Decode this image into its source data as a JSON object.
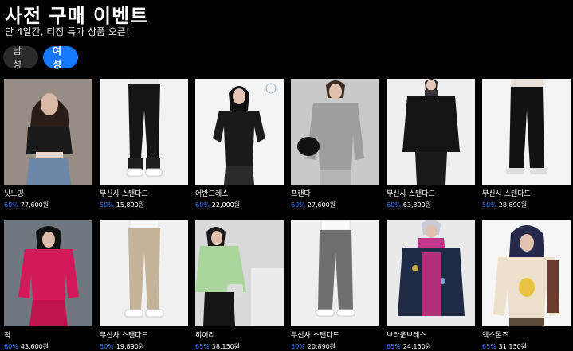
{
  "header": {
    "title": "사전 구매 이벤트",
    "subtitle": "단 4일간, 티징 특가 상품 오픈!"
  },
  "tabs": [
    {
      "label": "남성",
      "active": false
    },
    {
      "label": "여성",
      "active": true
    }
  ],
  "products": [
    {
      "name": "낫노밍",
      "discount": "60%",
      "price": "77,600원",
      "image": "woman-black-leather-crop-vest-denim"
    },
    {
      "name": "무신사 스탠다드",
      "discount": "50%",
      "price": "15,890원",
      "image": "black-jogger-pants-white-sneakers"
    },
    {
      "name": "어반드레스",
      "discount": "60%",
      "price": "22,000원",
      "image": "woman-black-cropped-cardigan"
    },
    {
      "name": "프랜다",
      "discount": "60%",
      "price": "27,600원",
      "image": "woman-grey-sweatshirt-black-bag"
    },
    {
      "name": "무신사 스탠다드",
      "discount": "60%",
      "price": "63,890원",
      "image": "black-double-breasted-coat"
    },
    {
      "name": "무신사 스탠다드",
      "discount": "50%",
      "price": "28,890원",
      "image": "black-wide-slacks"
    },
    {
      "name": "척",
      "discount": "60%",
      "price": "43,600원",
      "image": "woman-pink-hooded-zip-up-set"
    },
    {
      "name": "무신사 스탠다드",
      "discount": "50%",
      "price": "19,890원",
      "image": "beige-tapered-pants"
    },
    {
      "name": "히어리",
      "discount": "65%",
      "price": "38,150원",
      "image": "woman-green-sheer-shirt"
    },
    {
      "name": "무신사 스탠다드",
      "discount": "50%",
      "price": "20,890원",
      "image": "grey-wide-slacks"
    },
    {
      "name": "브라운브레스",
      "discount": "65%",
      "price": "24,150원",
      "image": "woman-printed-fleece-pink-hoodie"
    },
    {
      "name": "액스톤즈",
      "discount": "65%",
      "price": "31,150원",
      "image": "woman-cream-graphic-sweatshirt"
    }
  ],
  "colors": {
    "accent": "#1677ff",
    "discount": "#2f7bff",
    "background": "#000000"
  }
}
